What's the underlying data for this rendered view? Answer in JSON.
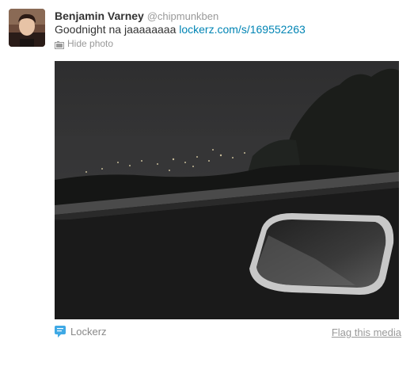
{
  "tweet": {
    "fullname": "Benjamin Varney",
    "handle": "@chipmunkben",
    "text": "Goodnight na jaaaaaaaa",
    "link": "lockerz.com/s/169552263",
    "hide_photo_label": "Hide photo"
  },
  "media": {
    "provider_label": "Lockerz",
    "flag_label": "Flag this media"
  },
  "icons": {
    "avatar": "profile-avatar",
    "hide_photo": "photo-icon",
    "provider": "speech-bubble-icon"
  },
  "colors": {
    "link": "#0084b4",
    "provider_icon": "#3fa9e5",
    "muted_text": "#999999"
  }
}
